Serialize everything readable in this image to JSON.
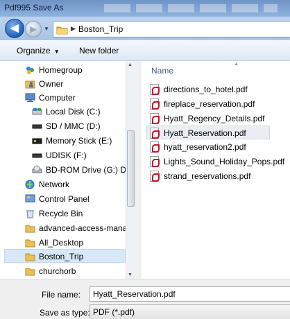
{
  "window": {
    "title": "Pdf995 Save As"
  },
  "navbar": {
    "back_glyph": "◀",
    "forward_glyph": "▶",
    "history_glyph": "▼",
    "breadcrumb_arrow": "▶",
    "breadcrumb": "Boston_Trip"
  },
  "toolbar": {
    "organize": "Organize",
    "organize_dropdown": "▼",
    "new_folder": "New folder"
  },
  "nav_pane": {
    "items": [
      {
        "label": "Homegroup",
        "icon": "homegroup-icon"
      },
      {
        "label": "Owner",
        "icon": "user-folder-icon"
      },
      {
        "label": "Computer",
        "icon": "computer-icon"
      },
      {
        "label": "Local Disk (C:)",
        "icon": "hard-disk-icon"
      },
      {
        "label": "SD / MMC (D:)",
        "icon": "removable-drive-icon"
      },
      {
        "label": "Memory Stick (E:)",
        "icon": "memory-stick-icon"
      },
      {
        "label": "UDISK (F:)",
        "icon": "usb-drive-icon"
      },
      {
        "label": "BD-ROM Drive (G:) DN",
        "icon": "optical-drive-icon"
      },
      {
        "label": "Network",
        "icon": "network-icon"
      },
      {
        "label": "Control Panel",
        "icon": "control-panel-icon"
      },
      {
        "label": "Recycle Bin",
        "icon": "recycle-bin-icon"
      },
      {
        "label": "advanced-access-mana",
        "icon": "folder-icon"
      },
      {
        "label": "All_Desktop",
        "icon": "folder-icon"
      },
      {
        "label": "Boston_Trip",
        "icon": "folder-icon"
      },
      {
        "label": "churchorb",
        "icon": "folder-icon"
      }
    ],
    "selected": "Boston_Trip"
  },
  "file_pane": {
    "column_header": "Name",
    "sort_glyph": "▲",
    "files": [
      "directions_to_hotel.pdf",
      "fireplace_reservation.pdf",
      "Hyatt_Regency_Details.pdf",
      "Hyatt_Reservation.pdf",
      "hyatt_reservation2.pdf",
      "Lights_Sound_Holiday_Pops.pdf",
      "strand_reservations.pdf"
    ],
    "selected": "Hyatt_Reservation.pdf"
  },
  "scrollbar": {
    "up_glyph": "▲",
    "down_glyph": "▼"
  },
  "bottom": {
    "file_name_label": "File name:",
    "file_name_value": "Hyatt_Reservation.pdf",
    "save_as_type_label": "Save as type:",
    "save_as_type_value": "PDF (*.pdf)"
  },
  "colors": {
    "titlebar": "#7fa3d4",
    "navbar": "#b3cbeb",
    "selection": "#d9e8f8",
    "pdf_red": "#c8102e"
  }
}
